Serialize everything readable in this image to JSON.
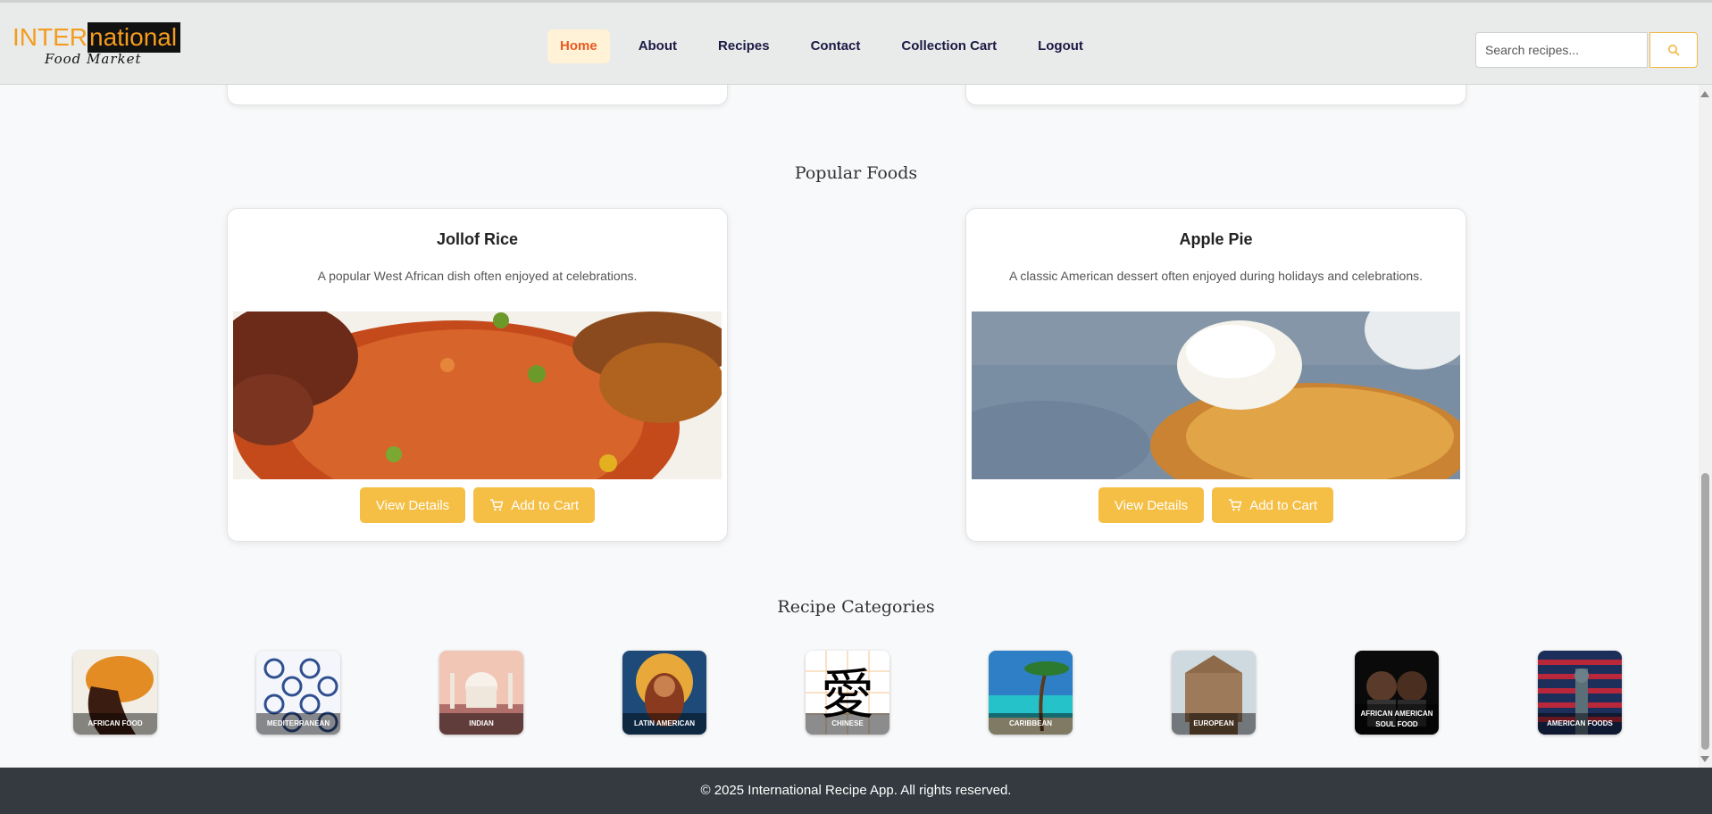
{
  "brand": {
    "logo_part1": "INTER",
    "logo_part2": "national",
    "logo_sub": "Food Market"
  },
  "nav": {
    "items": [
      {
        "label": "Home",
        "active": true
      },
      {
        "label": "About"
      },
      {
        "label": "Recipes"
      },
      {
        "label": "Contact"
      },
      {
        "label": "Collection Cart"
      },
      {
        "label": "Logout"
      }
    ]
  },
  "search": {
    "placeholder": "Search recipes...",
    "icon": "search-icon"
  },
  "popular": {
    "title": "Popular Foods",
    "foods": [
      {
        "name": "Jollof Rice",
        "description": "A popular West African dish often enjoyed at celebrations.",
        "view_label": "View Details",
        "cart_label": "Add to Cart"
      },
      {
        "name": "Apple Pie",
        "description": "A classic American dessert often enjoyed during holidays and celebrations.",
        "view_label": "View Details",
        "cart_label": "Add to Cart"
      }
    ]
  },
  "categories": {
    "title": "Recipe Categories",
    "items": [
      {
        "label": "African Food"
      },
      {
        "label": "Mediterranean"
      },
      {
        "label": "Indian"
      },
      {
        "label": "Latin American"
      },
      {
        "label": "Chinese"
      },
      {
        "label": "Caribbean"
      },
      {
        "label": "European"
      },
      {
        "label": "African American Soul Food"
      },
      {
        "label": "American Foods"
      }
    ]
  },
  "footer": {
    "text": "© 2025 International Recipe App. All rights reserved."
  },
  "colors": {
    "accent": "#f5bf45",
    "nav_active": "#ea5a22",
    "nav_text": "#1c1a44",
    "footer_bg": "#343a40"
  }
}
